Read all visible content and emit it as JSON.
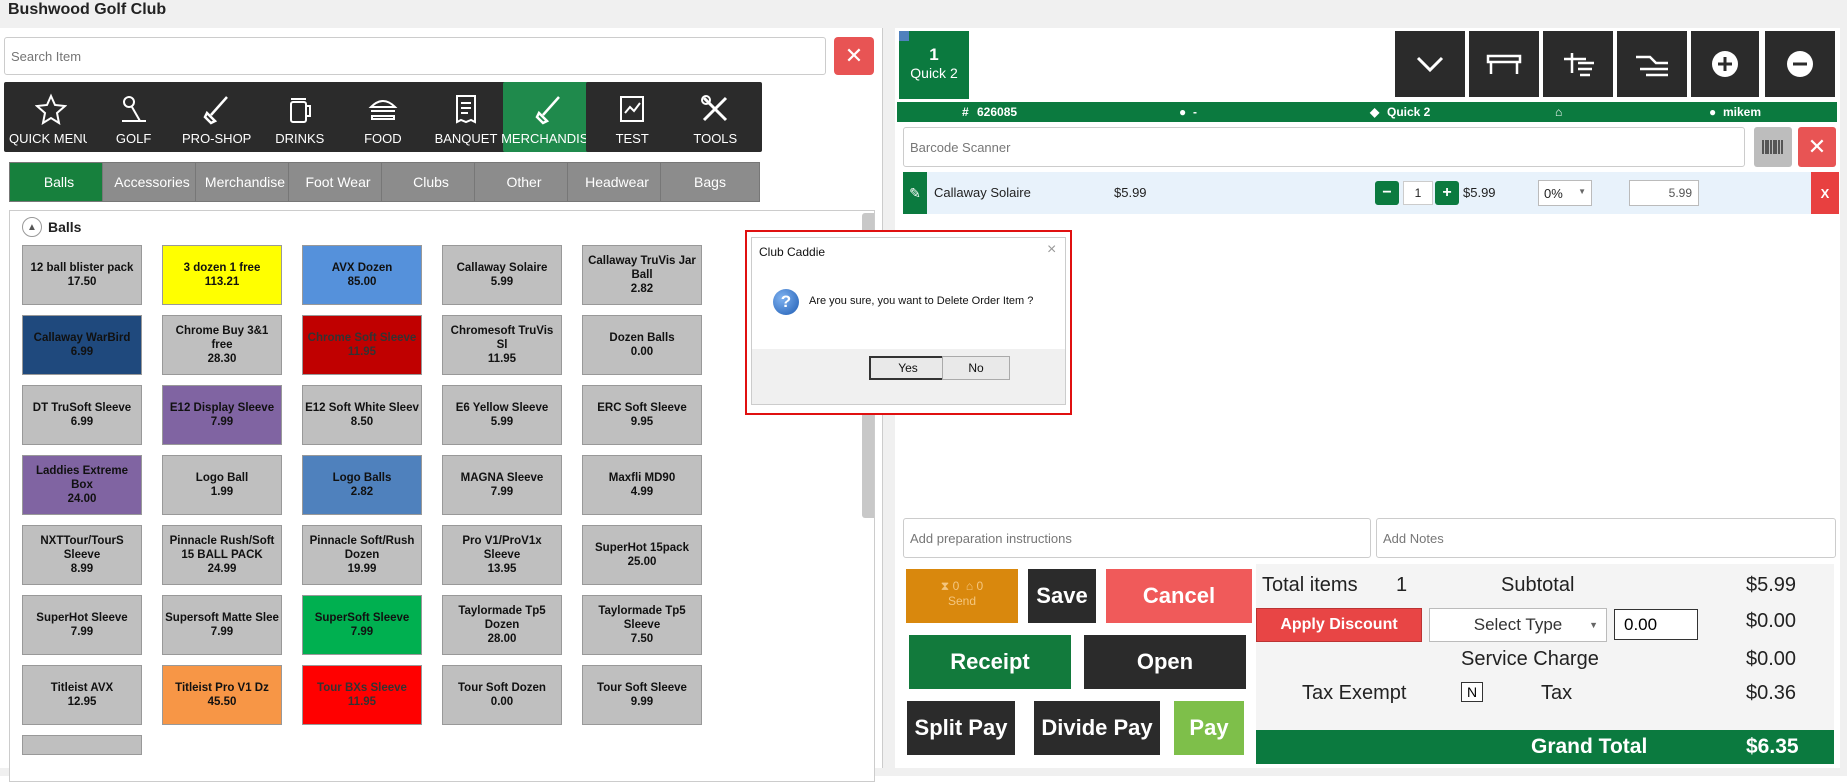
{
  "window": {
    "title": "Bushwood Golf Club"
  },
  "search": {
    "placeholder": "Search Item",
    "clear": "✕"
  },
  "categories": [
    {
      "label": "QUICK MENU",
      "icon": "star-icon"
    },
    {
      "label": "GOLF",
      "icon": "golf-icon"
    },
    {
      "label": "PRO-SHOP",
      "icon": "club-icon"
    },
    {
      "label": "DRINKS",
      "icon": "beer-icon"
    },
    {
      "label": "FOOD",
      "icon": "burger-icon"
    },
    {
      "label": "BANQUET",
      "icon": "receipt-icon"
    },
    {
      "label": "MERCHANDISE",
      "icon": "club-icon"
    },
    {
      "label": "TEST",
      "icon": "chart-icon"
    },
    {
      "label": "TOOLS",
      "icon": "tools-icon"
    }
  ],
  "subcategories": [
    "Balls",
    "Accessories",
    "Merchandise",
    "Foot Wear",
    "Clubs",
    "Other",
    "Headwear",
    "Bags"
  ],
  "section": {
    "title": "Balls"
  },
  "items": [
    {
      "name": "12 ball blister pack",
      "price": "17.50",
      "color": "#bfbfbf"
    },
    {
      "name": "3 dozen 1 free",
      "price": "113.21",
      "color": "#ffff00"
    },
    {
      "name": "AVX Dozen",
      "price": "85.00",
      "color": "#5591db"
    },
    {
      "name": "Callaway Solaire",
      "price": "5.99",
      "color": "#bfbfbf"
    },
    {
      "name": "Callaway TruVis Jar Ball",
      "price": "2.82",
      "color": "#bfbfbf"
    },
    {
      "name": "Callaway WarBird",
      "price": "6.99",
      "color": "#1f497d"
    },
    {
      "name": "Chrome Buy 3&1 free",
      "price": "28.30",
      "color": "#bfbfbf"
    },
    {
      "name": "Chrome Soft Sleeve",
      "price": "11.95",
      "color": "#c00000"
    },
    {
      "name": "Chromesoft TruVis Sl",
      "price": "11.95",
      "color": "#bfbfbf"
    },
    {
      "name": "Dozen Balls",
      "price": "0.00",
      "color": "#bfbfbf"
    },
    {
      "name": "DT TruSoft Sleeve",
      "price": "6.99",
      "color": "#bfbfbf"
    },
    {
      "name": "E12 Display Sleeve",
      "price": "7.99",
      "color": "#8064a2"
    },
    {
      "name": "E12 Soft White Sleev",
      "price": "8.50",
      "color": "#bfbfbf"
    },
    {
      "name": "E6 Yellow Sleeve",
      "price": "5.99",
      "color": "#bfbfbf"
    },
    {
      "name": "ERC Soft Sleeve",
      "price": "9.95",
      "color": "#bfbfbf"
    },
    {
      "name": "Laddies Extreme Box",
      "price": "24.00",
      "color": "#8064a2"
    },
    {
      "name": "Logo Ball",
      "price": "1.99",
      "color": "#bfbfbf"
    },
    {
      "name": "Logo Balls",
      "price": "2.82",
      "color": "#4f81bd"
    },
    {
      "name": "MAGNA Sleeve",
      "price": "7.99",
      "color": "#bfbfbf"
    },
    {
      "name": "Maxfli MD90",
      "price": "4.99",
      "color": "#bfbfbf"
    },
    {
      "name": "NXTTour/TourS Sleeve",
      "price": "8.99",
      "color": "#bfbfbf"
    },
    {
      "name": "Pinnacle Rush/Soft 15 BALL PACK",
      "price": "24.99",
      "color": "#bfbfbf"
    },
    {
      "name": "Pinnacle Soft/Rush Dozen",
      "price": "19.99",
      "color": "#bfbfbf"
    },
    {
      "name": "Pro V1/ProV1x Sleeve",
      "price": "13.95",
      "color": "#bfbfbf"
    },
    {
      "name": "SuperHot 15pack",
      "price": "25.00",
      "color": "#bfbfbf"
    },
    {
      "name": "SuperHot Sleeve",
      "price": "7.99",
      "color": "#bfbfbf"
    },
    {
      "name": "Supersoft Matte Slee",
      "price": "7.99",
      "color": "#bfbfbf"
    },
    {
      "name": "SuperSoft Sleeve",
      "price": "7.99",
      "color": "#00b050"
    },
    {
      "name": "Taylormade Tp5 Dozen",
      "price": "28.00",
      "color": "#bfbfbf"
    },
    {
      "name": "Taylormade Tp5 Sleeve",
      "price": "7.50",
      "color": "#bfbfbf"
    },
    {
      "name": "Titleist AVX",
      "price": "12.95",
      "color": "#bfbfbf"
    },
    {
      "name": "Titleist Pro V1 Dz",
      "price": "45.50",
      "color": "#f79646"
    },
    {
      "name": "Tour BXs Sleeve",
      "price": "11.95",
      "color": "#ff0000"
    },
    {
      "name": "Tour Soft Dozen",
      "price": "0.00",
      "color": "#bfbfbf"
    },
    {
      "name": "Tour Soft Sleeve",
      "price": "9.99",
      "color": "#bfbfbf"
    }
  ],
  "order_tab": {
    "number": "1",
    "label": "Quick 2"
  },
  "order_info": {
    "ticket": "626085",
    "customer": "-",
    "tag": "Quick 2",
    "user": "mikem"
  },
  "barcode": {
    "placeholder": "Barcode Scanner"
  },
  "order_item": {
    "name": "Callaway Solaire",
    "price": "$5.99",
    "qty": "1",
    "line_price": "$5.99",
    "discount": "0%",
    "total": "5.99",
    "remove": "X"
  },
  "notes": {
    "prep_placeholder": "Add preparation instructions",
    "notes_placeholder": "Add Notes"
  },
  "send": {
    "count1": "0",
    "count2": "0",
    "label": "Send"
  },
  "buttons": {
    "save": "Save",
    "cancel": "Cancel",
    "receipt": "Receipt",
    "open": "Open",
    "split_pay": "Split Pay",
    "divide_pay": "Divide Pay",
    "pay": "Pay",
    "apply_discount": "Apply Discount"
  },
  "discount": {
    "select_type": "Select Type",
    "amount": "0.00"
  },
  "totals": {
    "total_items_label": "Total items",
    "total_items": "1",
    "subtotal_label": "Subtotal",
    "subtotal": "$5.99",
    "discount_value": "$0.00",
    "service_label": "Service Charge",
    "service": "$0.00",
    "tax_exempt_label": "Tax Exempt",
    "tax_exempt": "N",
    "tax_label": "Tax",
    "tax": "$0.36",
    "grand_label": "Grand Total",
    "grand": "$6.35"
  },
  "dialog": {
    "title": "Club Caddie",
    "message": "Are you sure, you want to Delete Order Item ?",
    "yes": "Yes",
    "no": "No",
    "close": "×"
  }
}
